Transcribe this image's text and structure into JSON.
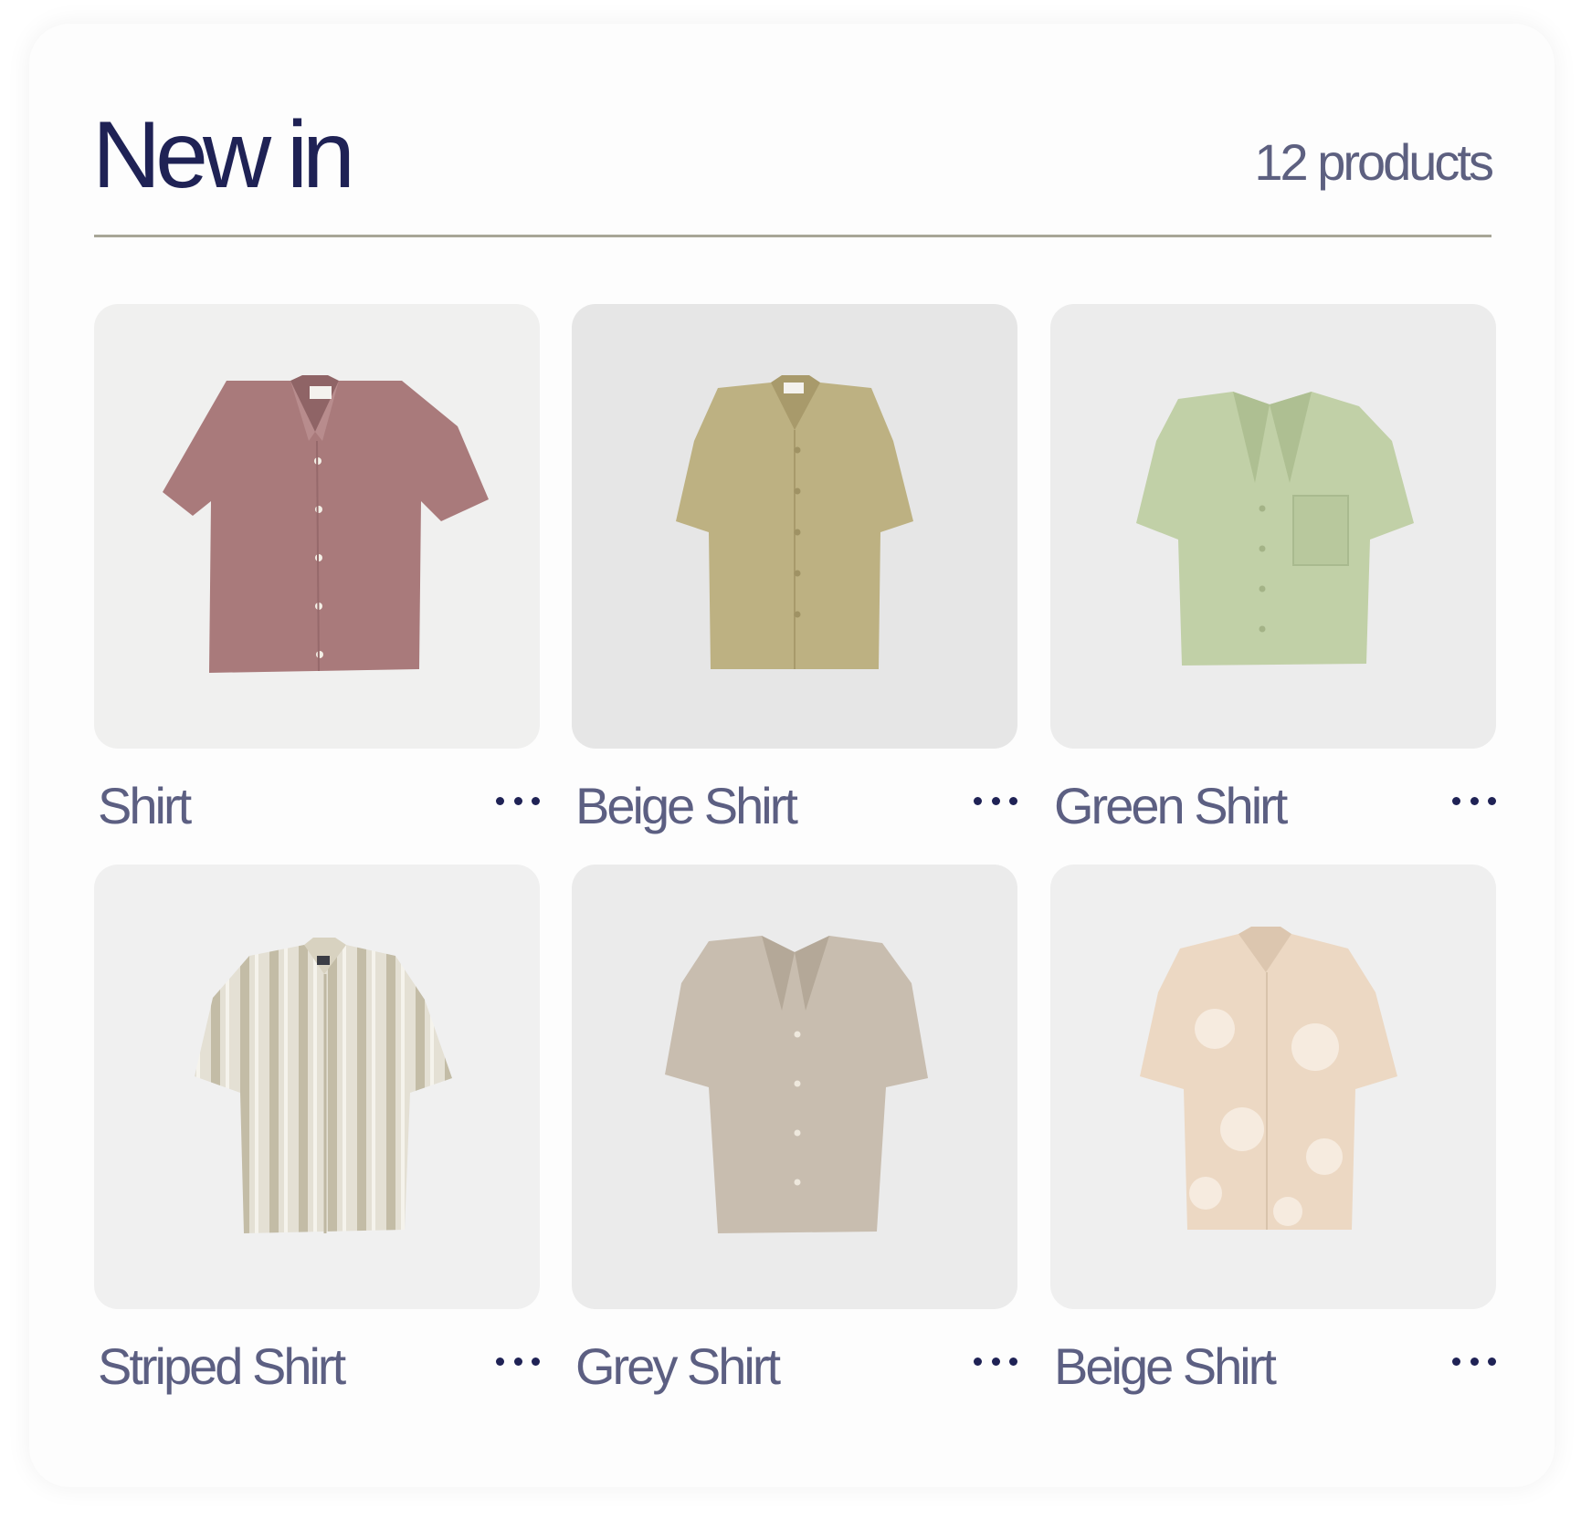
{
  "header": {
    "title": "New in",
    "product_count": "12 products"
  },
  "colors": {
    "title": "#1f2255",
    "text_muted": "#5c5f82",
    "divider": "#a8a697"
  },
  "products": [
    {
      "name": "Shirt",
      "image": "pink-shirt-image",
      "shirt_color": "#a97a7b",
      "background": "#f0f0ef",
      "more_icon": "more-horizontal-icon"
    },
    {
      "name": "Beige Shirt",
      "image": "khaki-shirt-image",
      "shirt_color": "#bdb182",
      "background": "#e6e6e6",
      "more_icon": "more-horizontal-icon"
    },
    {
      "name": "Green Shirt",
      "image": "green-shirt-image",
      "shirt_color": "#c1d0a7",
      "background": "#ececec",
      "more_icon": "more-horizontal-icon"
    },
    {
      "name": "Striped Shirt",
      "image": "striped-shirt-image",
      "shirt_color": "#dcd8cb",
      "background": "#f0f0f0",
      "more_icon": "more-horizontal-icon"
    },
    {
      "name": "Grey Shirt",
      "image": "grey-shirt-image",
      "shirt_color": "#c8bdaf",
      "background": "#ebebeb",
      "more_icon": "more-horizontal-icon"
    },
    {
      "name": "Beige Shirt",
      "image": "floral-beige-shirt-image",
      "shirt_color": "#ecd8c3",
      "background": "#efefef",
      "more_icon": "more-horizontal-icon"
    }
  ]
}
